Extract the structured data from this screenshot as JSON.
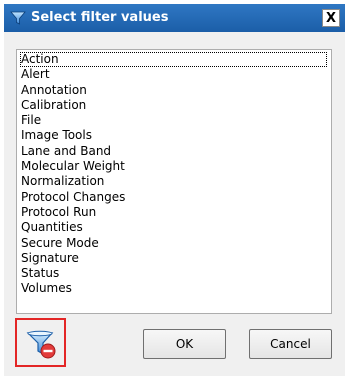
{
  "dialog": {
    "title": "Select filter values",
    "close_label": "X",
    "title_icon": "funnel-icon"
  },
  "filter_list": {
    "items": [
      "Action",
      "Alert",
      "Annotation",
      "Calibration",
      "File",
      "Image Tools",
      "Lane and Band",
      "Molecular Weight",
      "Normalization",
      "Protocol Changes",
      "Protocol Run",
      "Quantities",
      "Secure Mode",
      "Signature",
      "Status",
      "Volumes"
    ],
    "focused_item": "Action"
  },
  "buttons": {
    "ok_label": "OK",
    "cancel_label": "Cancel",
    "clear_filter_icon": "clear-filter-icon"
  },
  "colors": {
    "titlebar": "#1f64ae",
    "highlight_border": "#e32626",
    "funnel_blue": "#3a86d6",
    "remove_badge": "#e23b3b"
  }
}
